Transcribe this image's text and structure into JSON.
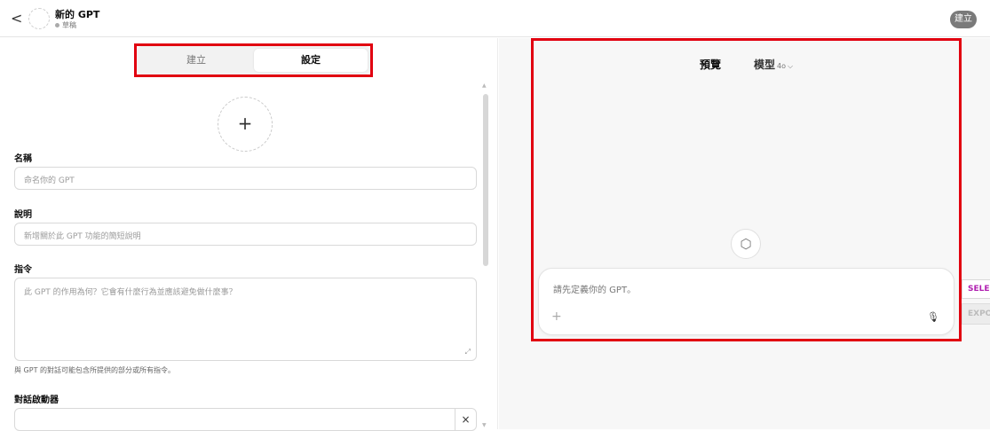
{
  "header": {
    "back_glyph": "<",
    "title": "新的 GPT",
    "status": "草稿",
    "create_button": "建立"
  },
  "tabs": [
    {
      "label": "建立",
      "active": false
    },
    {
      "label": "設定",
      "active": true
    }
  ],
  "form": {
    "avatar_plus": "+",
    "name_label": "名稱",
    "name_placeholder": "命名你的 GPT",
    "description_label": "說明",
    "description_placeholder": "新增關於此 GPT 功能的簡短說明",
    "instructions_label": "指令",
    "instructions_placeholder": "此 GPT 的作用為何？它會有什麼行為並應該避免做什麼事？",
    "instructions_hint": "與 GPT 的對話可能包含所提供的部分或所有指令。",
    "starters_label": "對話啟動器",
    "starter_remove": "×"
  },
  "preview": {
    "title": "預覽",
    "model_label": "模型",
    "model_version": "4o",
    "composer_placeholder": "請先定義你的 GPT。",
    "composer_plus": "+",
    "mic_glyph": "🎙"
  },
  "side_buttons": {
    "select": "SELE",
    "export": "EXPO"
  },
  "colors": {
    "highlight": "#e10010",
    "create_button_bg": "#7a7a7a",
    "select_text": "#b020b0"
  }
}
